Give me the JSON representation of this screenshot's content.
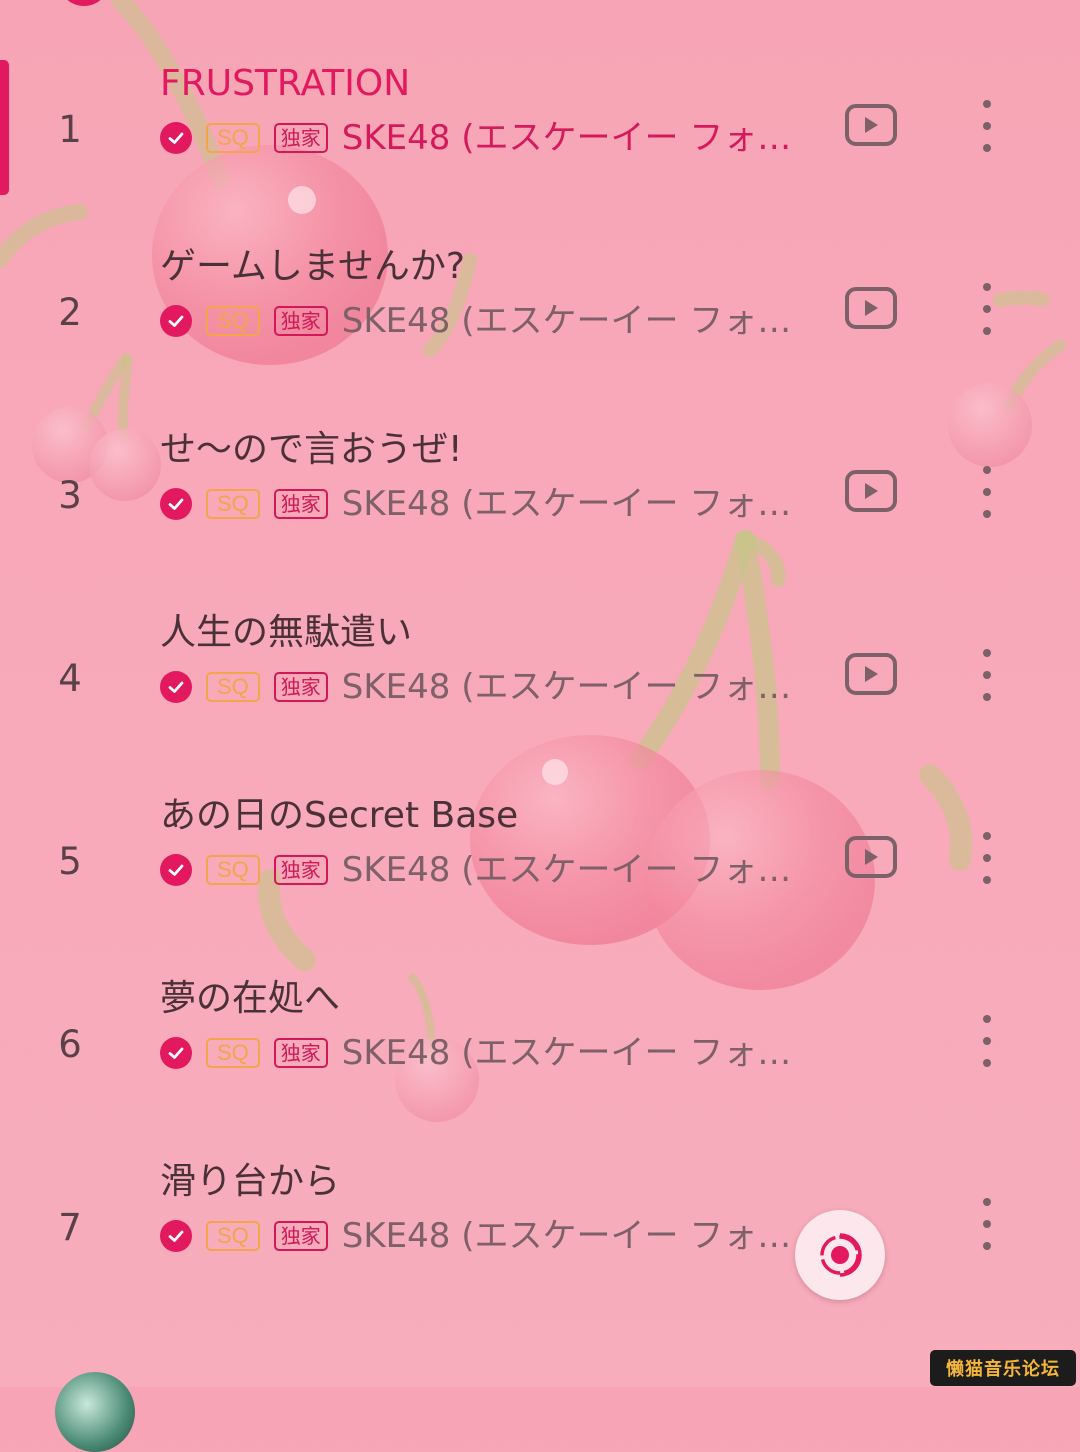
{
  "theme": {
    "accent": "#e3195f",
    "sq_color": "#f2a54a",
    "text_primary": "#4a3138",
    "text_secondary": "#7e6068",
    "background": "#f8a9b9"
  },
  "tracks": [
    {
      "number": "1",
      "title": "FRUSTRATION",
      "artist": "SKE48 (エスケーイー フォ…",
      "quality_badge": "SQ",
      "exclusive_badge": "独家",
      "has_mv": true,
      "playing": true
    },
    {
      "number": "2",
      "title": "ゲームしませんか?",
      "artist": "SKE48 (エスケーイー フォ…",
      "quality_badge": "SQ",
      "exclusive_badge": "独家",
      "has_mv": true,
      "playing": false
    },
    {
      "number": "3",
      "title": "せ～ので言おうぜ!",
      "artist": "SKE48 (エスケーイー フォ…",
      "quality_badge": "SQ",
      "exclusive_badge": "独家",
      "has_mv": true,
      "playing": false
    },
    {
      "number": "4",
      "title": "人生の無駄遣い",
      "artist": "SKE48 (エスケーイー フォ…",
      "quality_badge": "SQ",
      "exclusive_badge": "独家",
      "has_mv": true,
      "playing": false
    },
    {
      "number": "5",
      "title": "あの日のSecret Base",
      "artist": "SKE48 (エスケーイー フォ…",
      "quality_badge": "SQ",
      "exclusive_badge": "独家",
      "has_mv": true,
      "playing": false
    },
    {
      "number": "6",
      "title": "夢の在処へ",
      "artist": "SKE48 (エスケーイー フォ…",
      "quality_badge": "SQ",
      "exclusive_badge": "独家",
      "has_mv": false,
      "playing": false
    },
    {
      "number": "7",
      "title": "滑り台から",
      "artist": "SKE48 (エスケーイー フォ…",
      "quality_badge": "SQ",
      "exclusive_badge": "独家",
      "has_mv": false,
      "playing": false
    }
  ],
  "icons": {
    "downloaded": "check-circle-icon",
    "mv": "play-video-icon",
    "more": "more-vertical-icon",
    "locate": "locate-current-icon"
  },
  "watermark": {
    "text": "懒猫音乐论坛"
  }
}
